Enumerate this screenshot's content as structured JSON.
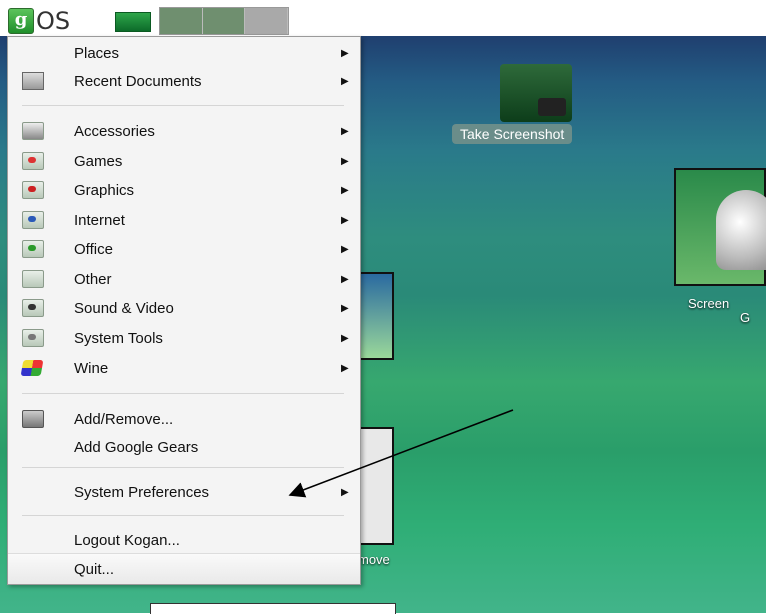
{
  "panel": {
    "logo_letter": "g",
    "logo_text": "OS"
  },
  "desktop": {
    "take_screenshot_label": "Take Screenshot",
    "screenshot_thumb_label_1": "Screen",
    "screenshot_thumb_label_2": "G",
    "thumb3_label": "move"
  },
  "menu": {
    "places": "Places",
    "recent": "Recent Documents",
    "categories": [
      {
        "label": "Accessories",
        "icon": "accessories-icon"
      },
      {
        "label": "Games",
        "icon": "games-icon"
      },
      {
        "label": "Graphics",
        "icon": "graphics-icon"
      },
      {
        "label": "Internet",
        "icon": "internet-icon"
      },
      {
        "label": "Office",
        "icon": "office-icon"
      },
      {
        "label": "Other",
        "icon": "folder-icon"
      },
      {
        "label": "Sound & Video",
        "icon": "sound-video-icon"
      },
      {
        "label": "System Tools",
        "icon": "system-tools-icon"
      },
      {
        "label": "Wine",
        "icon": "wine-icon"
      }
    ],
    "add_remove": "Add/Remove...",
    "add_google_gears": "Add Google Gears",
    "system_preferences": "System Preferences",
    "logout": "Logout Kogan...",
    "quit": "Quit...",
    "submenu_arrow": "▶"
  },
  "colors": {
    "accent": "#1f8e2a",
    "menu_bg": "#f4f4f4"
  }
}
